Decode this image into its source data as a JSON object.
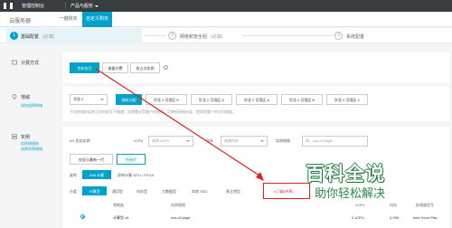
{
  "topbar": {
    "console": "管理控制台",
    "products": "产品与服务"
  },
  "subnav": {
    "title": "云服务器",
    "tab_one_click": "一键购买",
    "tab_custom": "自定义购买"
  },
  "steps": [
    {
      "num": "1",
      "label": "基础配置",
      "hint": "(必填)"
    },
    {
      "num": "2",
      "label": "网络和安全组",
      "hint": "(必填)"
    },
    {
      "num": "3",
      "label": "系统配置"
    }
  ],
  "billing": {
    "title": "计费方式",
    "options": [
      "包年包月",
      "按量付费",
      "抢占式实例"
    ],
    "help": "?"
  },
  "region": {
    "title": "地域",
    "link": "如何选择地域",
    "region_value": "华北 2",
    "zones": [
      "随机分配",
      "华北 2 可用区 E",
      "华北 2 可用区 D",
      "华北 2 可用区 A",
      "华北 2 可用区 B",
      "华北 2 可用区 C"
    ],
    "note1": "不同地域的实例之间内网互不相通；选择靠近您客户的地域，可降低网络时延、提高您客户的访问速度。",
    "note2": "如何选择地域"
  },
  "instance": {
    "title": "实例",
    "links": [
      "实例规格族",
      "选择实例规格"
    ],
    "io_label": "I/O 优化实例",
    "vcpu_label": "vCPU",
    "vcpu_placeholder": "选择 vCPU",
    "mem_label": "内存",
    "mem_placeholder": "选择内存",
    "spec_label": "实例规格",
    "spec_placeholder": "如：ecs.c5.large",
    "gen_tabs": [
      "仅显示最新一代",
      "所有代"
    ],
    "arch_label": "架构",
    "arch_tabs": [
      "X86 计算",
      "异构计算 GPU / FPGA"
    ],
    "class_label": "分类",
    "class_tabs": [
      "计算型",
      "通用型",
      "内存型",
      "大数据型",
      "本地 SSD",
      "高主频型",
      "入门级(共享)"
    ],
    "table_headers": [
      "规格族",
      "实例规格",
      "vCPU",
      "内存",
      "处理器型号"
    ],
    "row": {
      "family": "计算型 c5",
      "spec": "ecs.c5.large",
      "vcpu": "2 vCPU",
      "mem": "4 GiB",
      "cpu": "Intel Xeon Plat..."
    }
  },
  "watermark": {
    "title": "百科全说",
    "subtitle": "助你轻松解决"
  },
  "colors": {
    "accent": "#00a2ca",
    "highlight": "#e02020",
    "topbar": "#373d41"
  }
}
